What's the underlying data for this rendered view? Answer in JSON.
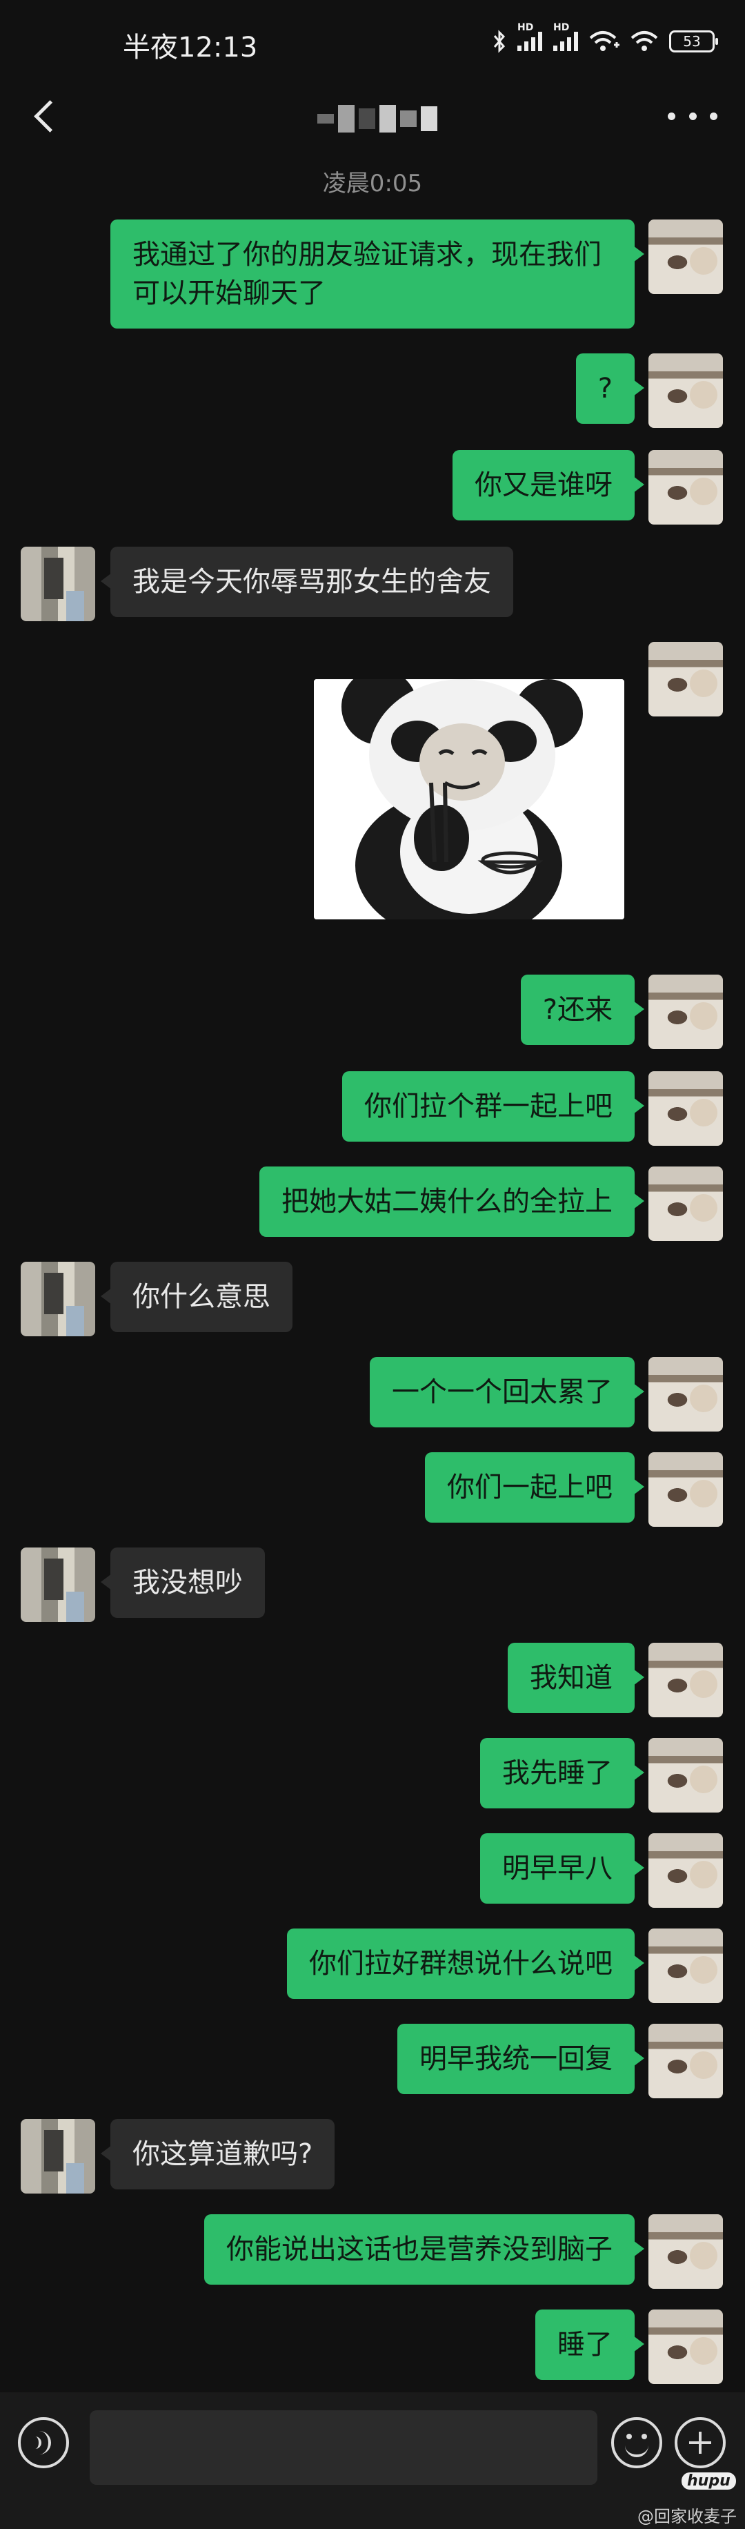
{
  "status_bar": {
    "time": "半夜12:13",
    "hd1": "HD",
    "hd2": "HD",
    "battery": "53",
    "icons": [
      "bluetooth-icon",
      "signal-icon",
      "signal-icon",
      "wifi-icon",
      "battery-icon"
    ]
  },
  "header": {
    "back_icon": "back-arrow-icon",
    "more_icon": "more-dots-icon"
  },
  "timestamp": "凌晨0:05",
  "messages": [
    {
      "from": "me",
      "text": "我通过了你的朋友验证请求，现在我们可以开始聊天了"
    },
    {
      "from": "me",
      "text": "?"
    },
    {
      "from": "me",
      "text": "你又是谁呀"
    },
    {
      "from": "other",
      "text": "我是今天你辱骂那女生的舍友"
    },
    {
      "from": "me",
      "type": "sticker",
      "sticker": "panda-meme-eating-sticker"
    },
    {
      "from": "me",
      "text": "?还来"
    },
    {
      "from": "me",
      "text": "你们拉个群一起上吧"
    },
    {
      "from": "me",
      "text": "把她大姑二姨什么的全拉上"
    },
    {
      "from": "other",
      "text": "你什么意思"
    },
    {
      "from": "me",
      "text": "一个一个回太累了"
    },
    {
      "from": "me",
      "text": "你们一起上吧"
    },
    {
      "from": "other",
      "text": "我没想吵"
    },
    {
      "from": "me",
      "text": "我知道"
    },
    {
      "from": "me",
      "text": "我先睡了"
    },
    {
      "from": "me",
      "text": "明早早八"
    },
    {
      "from": "me",
      "text": "你们拉好群想说什么说吧"
    },
    {
      "from": "me",
      "text": "明早我统一回复"
    },
    {
      "from": "other",
      "text": "你这算道歉吗?"
    },
    {
      "from": "me",
      "text": "你能说出这话也是营养没到脑子"
    },
    {
      "from": "me",
      "text": "睡了"
    }
  ],
  "input_bar": {
    "voice_icon": "voice-icon",
    "emoji_icon": "emoji-icon",
    "plus_icon": "plus-icon",
    "placeholder": ""
  },
  "watermark": {
    "logo": "hupu",
    "text": "@回家收麦子"
  },
  "colors": {
    "background": "#111111",
    "my_bubble": "#2ebd6a",
    "their_bubble": "#2c2c2c",
    "input_bar": "#1a1a1a"
  }
}
